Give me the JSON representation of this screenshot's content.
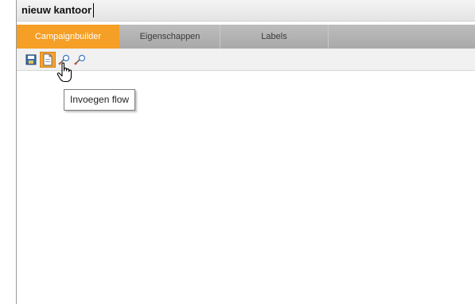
{
  "title_field": {
    "value": "nieuw kantoor"
  },
  "tabs": [
    {
      "label": "Campaignbuilder",
      "active": true
    },
    {
      "label": "Eigenschappen",
      "active": false
    },
    {
      "label": "Labels",
      "active": false
    }
  ],
  "toolbar": {
    "buttons": [
      {
        "icon": "save-icon"
      },
      {
        "icon": "insert-flow-icon",
        "active": true
      },
      {
        "icon": "zoom-in-icon"
      },
      {
        "icon": "zoom-out-icon"
      }
    ]
  },
  "tooltip": {
    "text": "Invoegen flow"
  },
  "colors": {
    "accent": "#f59f26"
  }
}
